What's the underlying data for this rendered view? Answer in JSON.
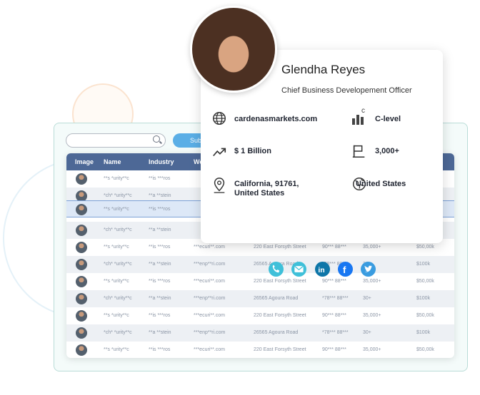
{
  "search": {
    "placeholder": ""
  },
  "submit_label": "Sub",
  "table": {
    "headers": [
      "Image",
      "Name",
      "Industry",
      "We"
    ],
    "rows": [
      {
        "name": "**s *urity**c",
        "industry": "**is ***ros",
        "website": "",
        "address": "",
        "phone": "",
        "employees": "",
        "revenue": ""
      },
      {
        "name": "*ch* *urity**c",
        "industry": "**a **stein",
        "website": "",
        "address": "",
        "phone": "",
        "employees": "",
        "revenue": ""
      },
      {
        "name": "**s *urity**c",
        "industry": "**is ***ros",
        "website": "",
        "address": "",
        "phone": "",
        "employees": "",
        "revenue": ""
      },
      {
        "name": "*ch* *urity**c",
        "industry": "**a **stein",
        "website": "",
        "address": "",
        "phone": "",
        "employees": "",
        "revenue": ""
      },
      {
        "name": "**s *urity**c",
        "industry": "**is ***ros",
        "website": "***ecuri**.com",
        "address": "220 East Forsyth Street",
        "phone": "90*** 88***",
        "employees": "35,000+",
        "revenue": "$50,00k"
      },
      {
        "name": "*ch* *urity**c",
        "industry": "**a **stein",
        "website": "***enp**ri.com",
        "address": "26565 Agoura Road",
        "phone": "*78*** 88***",
        "employees": "30+",
        "revenue": "$100k"
      },
      {
        "name": "**s *urity**c",
        "industry": "**is ***ros",
        "website": "***ecuri**.com",
        "address": "220 East Forsyth Street",
        "phone": "90*** 88***",
        "employees": "35,000+",
        "revenue": "$50,00k"
      },
      {
        "name": "*ch* *urity**c",
        "industry": "**a **stein",
        "website": "***enp**ri.com",
        "address": "26565 Agoura Road",
        "phone": "*78*** 88***",
        "employees": "30+",
        "revenue": "$100k"
      },
      {
        "name": "**s *urity**c",
        "industry": "**is ***ros",
        "website": "***ecuri**.com",
        "address": "220 East Forsyth Street",
        "phone": "90*** 88***",
        "employees": "35,000+",
        "revenue": "$50,00k"
      },
      {
        "name": "*ch* *urity**c",
        "industry": "**a **stein",
        "website": "***enp**ri.com",
        "address": "26565 Agoura Road",
        "phone": "*78*** 88***",
        "employees": "30+",
        "revenue": "$100k"
      },
      {
        "name": "**s *urity**c",
        "industry": "**is ***ros",
        "website": "***ecuri**.com",
        "address": "220 East Forsyth Street",
        "phone": "90*** 88***",
        "employees": "35,000+",
        "revenue": "$50,00k"
      }
    ]
  },
  "profile": {
    "name": "Glendha Reyes",
    "title": "Chief Business Developement Officer",
    "website": "cardenasmarkets.com",
    "level": "C-level",
    "revenue": "$ 1 Billion",
    "employees": "3,000+",
    "location_line1": "California, 91761,",
    "location_line2": "United States",
    "country": "United States",
    "social": [
      {
        "icon": "phone-icon",
        "color": "#3fc0d9"
      },
      {
        "icon": "email-icon",
        "color": "#3fc0d9"
      },
      {
        "icon": "linkedin-icon",
        "color": "#0e76a8"
      },
      {
        "icon": "facebook-icon",
        "color": "#1877f2"
      },
      {
        "icon": "twitter-icon",
        "color": "#3a9ce0"
      }
    ]
  },
  "colors": {
    "header": "#4d6896",
    "accent": "#5aaee6",
    "selected_row": "#dde8f7"
  }
}
